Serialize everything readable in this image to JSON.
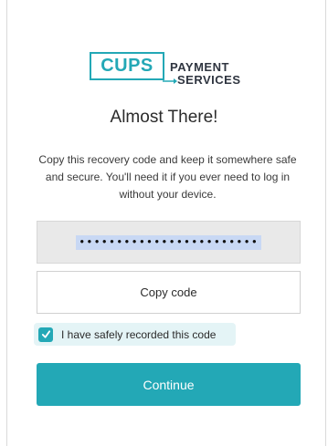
{
  "brand": {
    "logo_main": "CUPS",
    "logo_line1": "PAYMENT",
    "logo_line2": "SERVICES",
    "accent_color": "#23a8b6"
  },
  "title": "Almost There!",
  "description": "Copy this recovery code and keep it somewhere safe and secure. You'll need it if you ever need to log in without your device.",
  "recovery_code": {
    "value": "••••••••••••••••••••••••",
    "redacted": true
  },
  "copy_button": {
    "label": "Copy code"
  },
  "confirm_checkbox": {
    "label": "I have safely recorded this code",
    "checked": true
  },
  "continue_button": {
    "label": "Continue"
  },
  "icons": {
    "check": "check-icon",
    "arrow": "arrow-right-icon"
  }
}
